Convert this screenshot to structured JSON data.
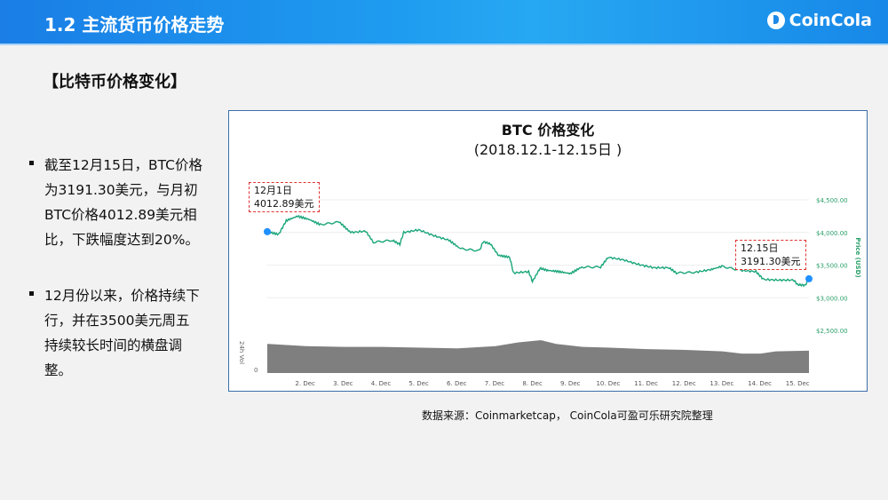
{
  "header": {
    "title": "1.2  主流货币价格走势",
    "brand": "CoinCola"
  },
  "section_title": "【比特币价格变化】",
  "bullets": [
    {
      "lines": [
        "截至12月15日，BTC价格",
        "为3191.30美元，与月初",
        "BTC价格4012.89美元相",
        "比，下跌幅度达到20%。"
      ]
    },
    {
      "lines": [
        "12月份以来，价格持续下",
        "行，并在3500美元周五",
        "持续较长时间的横盘调",
        "整。"
      ]
    }
  ],
  "source": "数据来源：Coinmarketcap， CoinCola可盈可乐研究院整理",
  "chart_data": {
    "type": "line",
    "title": "BTC 价格变化",
    "subtitle": "(2018.12.1-12.15日 )",
    "ylabel": "Price (USD)",
    "y2label": "24h Vol",
    "y2tick": "0",
    "ylim": [
      2500,
      4700
    ],
    "yticks": [
      {
        "v": 4500,
        "label": "$4,500.00"
      },
      {
        "v": 4000,
        "label": "$4,000.00"
      },
      {
        "v": 3500,
        "label": "$3,500.00"
      },
      {
        "v": 3000,
        "label": "$3,000.00"
      },
      {
        "v": 2500,
        "label": "$2,500.00"
      }
    ],
    "xlim": [
      1.0,
      15.3
    ],
    "xticks": [
      {
        "v": 2,
        "label": "2. Dec"
      },
      {
        "v": 3,
        "label": "3. Dec"
      },
      {
        "v": 4,
        "label": "4. Dec"
      },
      {
        "v": 5,
        "label": "5. Dec"
      },
      {
        "v": 6,
        "label": "6. Dec"
      },
      {
        "v": 7,
        "label": "7. Dec"
      },
      {
        "v": 8,
        "label": "8. Dec"
      },
      {
        "v": 9,
        "label": "9. Dec"
      },
      {
        "v": 10,
        "label": "10. Dec"
      },
      {
        "v": 11,
        "label": "11. Dec"
      },
      {
        "v": 12,
        "label": "12. Dec"
      },
      {
        "v": 13,
        "label": "13. Dec"
      },
      {
        "v": 14,
        "label": "14. Dec"
      },
      {
        "v": 15,
        "label": "15. Dec"
      }
    ],
    "price": [
      [
        1.0,
        4012
      ],
      [
        1.3,
        3970
      ],
      [
        1.5,
        4180
      ],
      [
        1.8,
        4250
      ],
      [
        2.1,
        4200
      ],
      [
        2.4,
        4120
      ],
      [
        2.9,
        4160
      ],
      [
        3.2,
        4000
      ],
      [
        3.6,
        4020
      ],
      [
        3.8,
        3850
      ],
      [
        4.3,
        3880
      ],
      [
        4.5,
        3820
      ],
      [
        4.6,
        4000
      ],
      [
        5.0,
        4040
      ],
      [
        5.4,
        3950
      ],
      [
        5.8,
        3880
      ],
      [
        6.1,
        3750
      ],
      [
        6.6,
        3720
      ],
      [
        6.7,
        3860
      ],
      [
        6.9,
        3820
      ],
      [
        7.1,
        3650
      ],
      [
        7.4,
        3620
      ],
      [
        7.5,
        3380
      ],
      [
        7.9,
        3400
      ],
      [
        8.0,
        3250
      ],
      [
        8.2,
        3450
      ],
      [
        8.4,
        3420
      ],
      [
        8.7,
        3400
      ],
      [
        9.0,
        3370
      ],
      [
        9.3,
        3470
      ],
      [
        9.8,
        3470
      ],
      [
        10.0,
        3620
      ],
      [
        10.4,
        3580
      ],
      [
        10.8,
        3510
      ],
      [
        11.2,
        3460
      ],
      [
        11.6,
        3460
      ],
      [
        11.8,
        3380
      ],
      [
        12.3,
        3390
      ],
      [
        12.7,
        3430
      ],
      [
        13.0,
        3480
      ],
      [
        13.5,
        3420
      ],
      [
        13.9,
        3400
      ],
      [
        14.1,
        3280
      ],
      [
        14.5,
        3270
      ],
      [
        14.9,
        3270
      ],
      [
        15.0,
        3200
      ],
      [
        15.2,
        3191
      ],
      [
        15.3,
        3290
      ]
    ],
    "volume": [
      [
        1.0,
        0.78
      ],
      [
        2.0,
        0.72
      ],
      [
        3.0,
        0.7
      ],
      [
        4.0,
        0.7
      ],
      [
        5.0,
        0.68
      ],
      [
        6.0,
        0.66
      ],
      [
        7.0,
        0.72
      ],
      [
        7.6,
        0.82
      ],
      [
        8.2,
        0.88
      ],
      [
        8.6,
        0.78
      ],
      [
        9.3,
        0.7
      ],
      [
        10.0,
        0.68
      ],
      [
        11.0,
        0.64
      ],
      [
        12.0,
        0.62
      ],
      [
        13.0,
        0.58
      ],
      [
        13.5,
        0.52
      ],
      [
        14.0,
        0.52
      ],
      [
        14.4,
        0.58
      ],
      [
        15.3,
        0.6
      ]
    ],
    "annotations": [
      {
        "label": "12月1日",
        "value": "4012.89美元"
      },
      {
        "label": "12.15日",
        "value": "3191.30美元"
      }
    ],
    "colors": {
      "line": "#1aa67a",
      "marker": "#1e90ff",
      "volume": "#7f7f7f",
      "axis": "#2ca06a"
    }
  }
}
